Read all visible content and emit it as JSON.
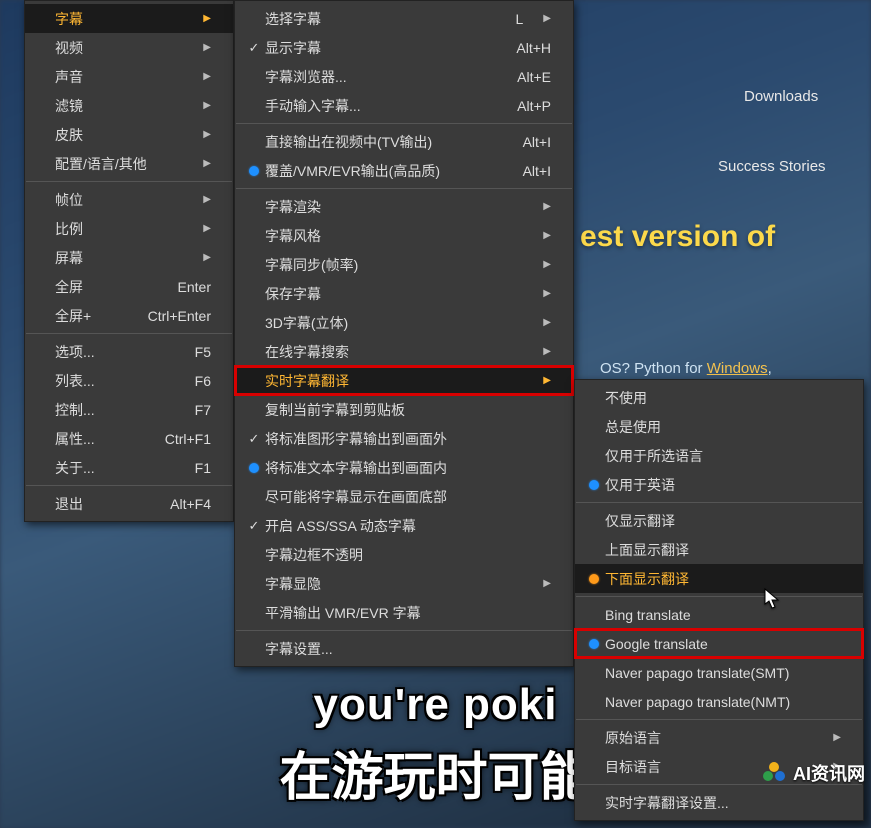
{
  "background": {
    "nav1": "Downloads",
    "nav2": "Success Stories",
    "heading_frag": "est version of",
    "os_frag": "OS? Python for",
    "os_frag2": "Windows",
    "subtitle_en": "you're poki",
    "subtitle_zh": "在游玩时可能"
  },
  "watermark": "AI资讯网",
  "menu1": {
    "items": [
      {
        "label": "字幕",
        "sub": true,
        "hl": true
      },
      {
        "label": "视频",
        "sub": true
      },
      {
        "label": "声音",
        "sub": true
      },
      {
        "label": "滤镜",
        "sub": true
      },
      {
        "label": "皮肤",
        "sub": true
      },
      {
        "label": "配置/语言/其他",
        "sub": true
      },
      {
        "sep": true
      },
      {
        "label": "帧位",
        "sub": true
      },
      {
        "label": "比例",
        "sub": true
      },
      {
        "label": "屏幕",
        "sub": true
      },
      {
        "label": "全屏",
        "accel": "Enter"
      },
      {
        "label": "全屏+",
        "accel": "Ctrl+Enter"
      },
      {
        "sep": true
      },
      {
        "label": "选项...",
        "accel": "F5"
      },
      {
        "label": "列表...",
        "accel": "F6"
      },
      {
        "label": "控制...",
        "accel": "F7"
      },
      {
        "label": "属性...",
        "accel": "Ctrl+F1"
      },
      {
        "label": "关于...",
        "accel": "F1"
      },
      {
        "sep": true
      },
      {
        "label": "退出",
        "accel": "Alt+F4"
      }
    ]
  },
  "menu2": {
    "items": [
      {
        "label": "选择字幕",
        "accel": "L",
        "sub": true
      },
      {
        "label": "显示字幕",
        "accel": "Alt+H",
        "check": true
      },
      {
        "label": "字幕浏览器...",
        "accel": "Alt+E"
      },
      {
        "label": "手动输入字幕...",
        "accel": "Alt+P"
      },
      {
        "sep": true
      },
      {
        "label": "直接输出在视频中(TV输出)",
        "accel": "Alt+I"
      },
      {
        "label": "覆盖/VMR/EVR输出(高品质)",
        "accel": "Alt+I",
        "radio": true
      },
      {
        "sep": true
      },
      {
        "label": "字幕渲染",
        "sub": true
      },
      {
        "label": "字幕风格",
        "sub": true
      },
      {
        "label": "字幕同步(帧率)",
        "sub": true
      },
      {
        "label": "保存字幕",
        "sub": true
      },
      {
        "label": "3D字幕(立体)",
        "sub": true
      },
      {
        "label": "在线字幕搜索",
        "sub": true
      },
      {
        "label": "实时字幕翻译",
        "sub": true,
        "hl": true,
        "red": true
      },
      {
        "label": "复制当前字幕到剪贴板"
      },
      {
        "label": "将标准图形字幕输出到画面外",
        "check": true
      },
      {
        "label": "将标准文本字幕输出到画面内",
        "radio": true
      },
      {
        "label": "尽可能将字幕显示在画面底部"
      },
      {
        "label": "开启 ASS/SSA 动态字幕",
        "check": true
      },
      {
        "label": "字幕边框不透明"
      },
      {
        "label": "字幕显隐",
        "sub": true
      },
      {
        "label": "平滑输出 VMR/EVR 字幕"
      },
      {
        "sep": true
      },
      {
        "label": "字幕设置..."
      }
    ]
  },
  "menu3": {
    "items": [
      {
        "label": "不使用"
      },
      {
        "label": "总是使用"
      },
      {
        "label": "仅用于所选语言"
      },
      {
        "label": "仅用于英语",
        "radio": true
      },
      {
        "sep": true
      },
      {
        "label": "仅显示翻译"
      },
      {
        "label": "上面显示翻译"
      },
      {
        "label": "下面显示翻译",
        "radio": true,
        "orange": true,
        "hl": true
      },
      {
        "sep": true
      },
      {
        "label": "Bing translate"
      },
      {
        "label": "Google translate",
        "radio": true,
        "red": true
      },
      {
        "label": "Naver papago translate(SMT)"
      },
      {
        "label": "Naver papago translate(NMT)"
      },
      {
        "sep": true
      },
      {
        "label": "原始语言",
        "sub": true
      },
      {
        "label": "目标语言",
        "sub": true
      },
      {
        "sep": true
      },
      {
        "label": "实时字幕翻译设置..."
      }
    ]
  }
}
